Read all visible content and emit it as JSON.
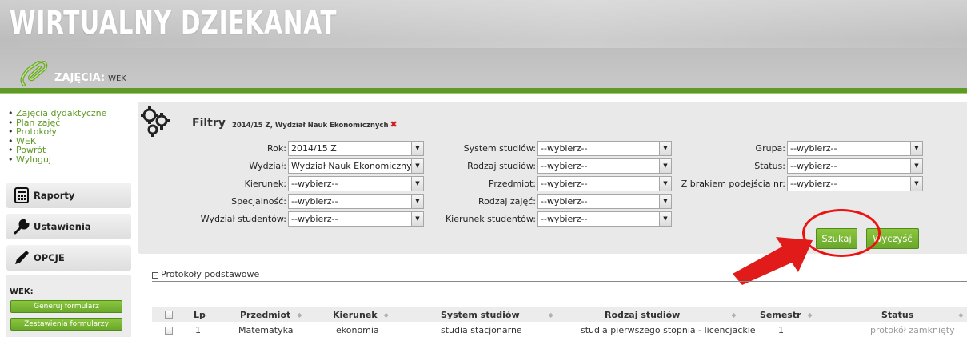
{
  "header": {
    "app_title": "WIRTUALNY DZIEKANAT",
    "section_label": "ZAJĘCIA:",
    "section_sub": "WEK"
  },
  "sidebar": {
    "nav": [
      {
        "label": "Zajęcia dydaktyczne"
      },
      {
        "label": "Plan zajęć"
      },
      {
        "label": "Protokoły"
      },
      {
        "label": "WEK"
      },
      {
        "label": "Powrót"
      },
      {
        "label": "Wyloguj"
      }
    ],
    "boxes": {
      "raporty": "Raporty",
      "ustawienia": "Ustawienia",
      "opcje": "OPCJE"
    },
    "wek_panel": {
      "title": "WEK:",
      "generate": "Generuj formularz",
      "summary": "Zestawienia formularzy"
    }
  },
  "filters": {
    "title": "Filtry",
    "summary": "2014/15 Z,  Wydział Nauk Ekonomicznych",
    "col1": [
      {
        "label": "Rok:",
        "value": "2014/15 Z"
      },
      {
        "label": "Wydział:",
        "value": "Wydział Nauk Ekonomicznych"
      },
      {
        "label": "Kierunek:",
        "value": "--wybierz--"
      },
      {
        "label": "Specjalność:",
        "value": "--wybierz--"
      },
      {
        "label": "Wydział studentów:",
        "value": "--wybierz--"
      }
    ],
    "col2": [
      {
        "label": "System studiów:",
        "value": "--wybierz--"
      },
      {
        "label": "Rodzaj studiów:",
        "value": "--wybierz--"
      },
      {
        "label": "Przedmiot:",
        "value": "--wybierz--"
      },
      {
        "label": "Rodzaj zajęć:",
        "value": "--wybierz--"
      },
      {
        "label": "Kierunek studentów:",
        "value": "--wybierz--"
      }
    ],
    "col3": [
      {
        "label": "Grupa:",
        "value": "--wybierz--"
      },
      {
        "label": "Status:",
        "value": "--wybierz--"
      },
      {
        "label": "Z brakiem podejścia nr:",
        "value": "--wybierz--"
      }
    ],
    "search_button": "Szukaj",
    "clear_button": "Wyczyść"
  },
  "protocols": {
    "section_title": "Protokoły podstawowe",
    "columns": {
      "lp": "Lp",
      "przedmiot": "Przedmiot",
      "kierunek": "Kierunek",
      "system": "System studiów",
      "rodzaj": "Rodzaj studiów",
      "semestr": "Semestr",
      "status": "Status"
    },
    "rows": [
      {
        "lp": "1",
        "przedmiot": "Matematyka",
        "kierunek": "ekonomia",
        "system": "studia stacjonarne",
        "rodzaj": "studia pierwszego stopnia - licencjackie",
        "semestr": "1",
        "status": "protokół zamknięty"
      }
    ]
  }
}
